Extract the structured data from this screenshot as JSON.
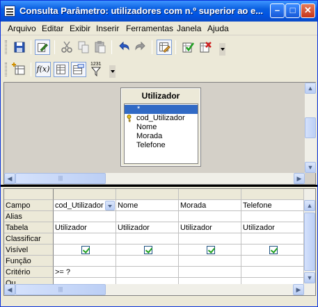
{
  "window": {
    "title": "Consulta Parâmetro: utilizadores com n.º superior ao e...",
    "minimize_glyph": "–",
    "maximize_glyph": "□",
    "close_glyph": "✕"
  },
  "menu": {
    "arquivo": "Arquivo",
    "editar": "Editar",
    "exibir": "Exibir",
    "inserir": "Inserir",
    "ferramentas": "Ferramentas",
    "janela": "Janela",
    "ajuda": "Ajuda"
  },
  "toolbar2": {
    "functions_label": "f(x)",
    "limit_label": "1231"
  },
  "design": {
    "table": {
      "name": "Utilizador",
      "fields": [
        "*",
        "cod_Utilizador",
        "Nome",
        "Morada",
        "Telefone"
      ],
      "key_field": "cod_Utilizador"
    }
  },
  "scroll": {
    "grip_glyph": "|||"
  },
  "grid": {
    "row_headers": [
      "Campo",
      "Alias",
      "Tabela",
      "Classificar",
      "Visível",
      "Função",
      "Critério",
      "Ou"
    ],
    "columns": [
      {
        "campo": "cod_Utilizador",
        "tabela": "Utilizador",
        "visivel": true,
        "criterio": ">= ?"
      },
      {
        "campo": "Nome",
        "tabela": "Utilizador",
        "visivel": true,
        "criterio": ""
      },
      {
        "campo": "Morada",
        "tabela": "Utilizador",
        "visivel": true,
        "criterio": ""
      },
      {
        "campo": "Telefone",
        "tabela": "Utilizador",
        "visivel": true,
        "criterio": ""
      }
    ]
  },
  "colors": {
    "title_bar": "#0054e3",
    "selection": "#316ac5",
    "check": "#21a121"
  }
}
